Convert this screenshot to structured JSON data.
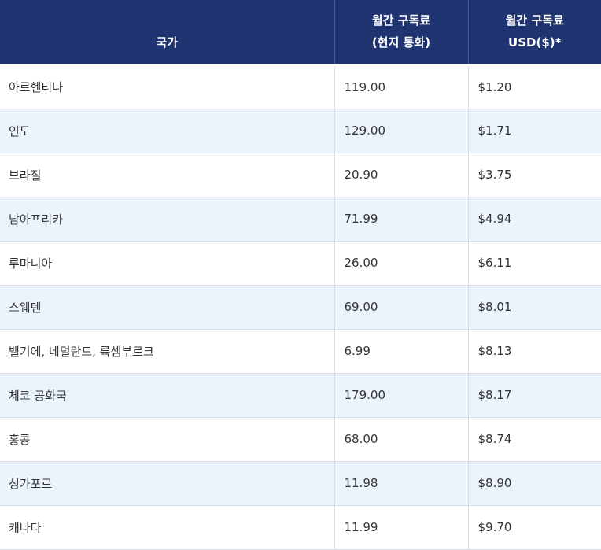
{
  "table": {
    "headers": {
      "country": "국가",
      "local_line1": "월간 구독료",
      "local_line2": "(현지 통화)",
      "usd_line1": "월간 구독료",
      "usd_line2": "USD($)*"
    },
    "rows": [
      {
        "country": "아르헨티나",
        "local": "119.00",
        "usd": "$1.20"
      },
      {
        "country": "인도",
        "local": "129.00",
        "usd": "$1.71"
      },
      {
        "country": "브라질",
        "local": "20.90",
        "usd": "$3.75"
      },
      {
        "country": "남아프리카",
        "local": "71.99",
        "usd": "$4.94"
      },
      {
        "country": "루마니아",
        "local": "26.00",
        "usd": "$6.11"
      },
      {
        "country": "스웨덴",
        "local": "69.00",
        "usd": "$8.01"
      },
      {
        "country": "벨기에, 네덜란드, 룩셈부르크",
        "local": "6.99",
        "usd": "$8.13"
      },
      {
        "country": "체코 공화국",
        "local": "179.00",
        "usd": "$8.17"
      },
      {
        "country": "홍콩",
        "local": "68.00",
        "usd": "$8.74"
      },
      {
        "country": "싱가포르",
        "local": "11.98",
        "usd": "$8.90"
      },
      {
        "country": "캐나다",
        "local": "11.99",
        "usd": "$9.70"
      }
    ]
  },
  "colors": {
    "header_bg": "#1f3470",
    "header_text": "#ffffff",
    "row_alt_bg": "#ebf4fc",
    "text": "#333333",
    "border": "#d9dde4"
  }
}
